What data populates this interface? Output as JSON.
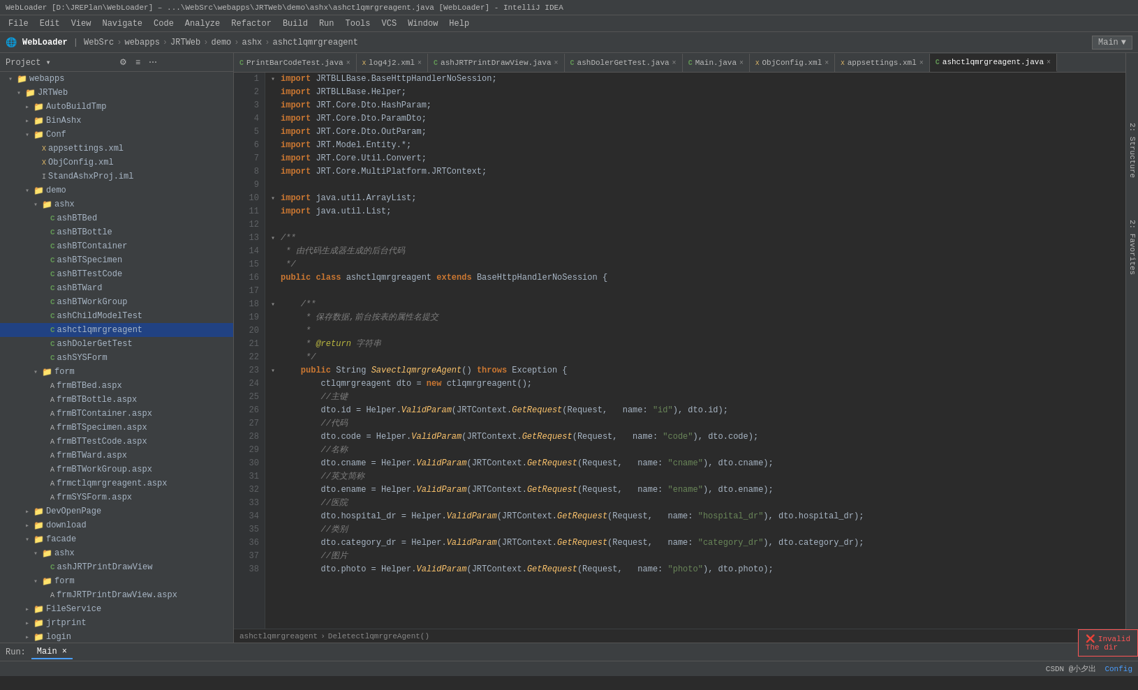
{
  "titlebar": {
    "text": "WebLoader [D:\\JREPlan\\WebLoader] – ...\\WebSrc\\webapps\\JRTWeb\\demo\\ashx\\ashctlqmrgreagent.java [WebLoader] - IntelliJ IDEA"
  },
  "menubar": {
    "items": [
      "File",
      "Edit",
      "View",
      "Navigate",
      "Code",
      "Analyze",
      "Refactor",
      "Build",
      "Run",
      "Tools",
      "VCS",
      "Window",
      "Help"
    ]
  },
  "toolbar": {
    "project_label": "WebLoader",
    "breadcrumb": [
      "WebSrc",
      "webapps",
      "JRTWeb",
      "demo",
      "ashx",
      "ashctlqmrgreagent"
    ],
    "run_config": "Main"
  },
  "project_panel": {
    "title": "Project",
    "tree": [
      {
        "id": "webapps",
        "label": "webapps",
        "type": "folder",
        "indent": 1,
        "expanded": true
      },
      {
        "id": "jrtweb",
        "label": "JRTWeb",
        "type": "folder",
        "indent": 2,
        "expanded": true
      },
      {
        "id": "autobuildtmp",
        "label": "AutoBuildTmp",
        "type": "folder",
        "indent": 3,
        "expanded": false
      },
      {
        "id": "binashx",
        "label": "BinAshx",
        "type": "folder",
        "indent": 3,
        "expanded": false
      },
      {
        "id": "conf",
        "label": "Conf",
        "type": "folder",
        "indent": 3,
        "expanded": true
      },
      {
        "id": "appsettings",
        "label": "appsettings.xml",
        "type": "xml",
        "indent": 4
      },
      {
        "id": "objconfig",
        "label": "ObjConfig.xml",
        "type": "xml",
        "indent": 4
      },
      {
        "id": "standashxproj",
        "label": "StandAshxProj.iml",
        "type": "iml",
        "indent": 4
      },
      {
        "id": "demo",
        "label": "demo",
        "type": "folder",
        "indent": 3,
        "expanded": true
      },
      {
        "id": "ashx",
        "label": "ashx",
        "type": "folder",
        "indent": 4,
        "expanded": true
      },
      {
        "id": "ashbtbed",
        "label": "ashBTBed",
        "type": "java",
        "indent": 5
      },
      {
        "id": "ashbtbottle",
        "label": "ashBTBottle",
        "type": "java",
        "indent": 5
      },
      {
        "id": "ashbtcontainer",
        "label": "ashBTContainer",
        "type": "java",
        "indent": 5
      },
      {
        "id": "ashbtspecimen",
        "label": "ashBTSpecimen",
        "type": "java",
        "indent": 5
      },
      {
        "id": "ashtbtestcode",
        "label": "ashBTTestCode",
        "type": "java",
        "indent": 5
      },
      {
        "id": "ashbtward",
        "label": "ashBTWard",
        "type": "java",
        "indent": 5
      },
      {
        "id": "ashbtworkgroup",
        "label": "ashBTWorkGroup",
        "type": "java",
        "indent": 5
      },
      {
        "id": "ashchildmodeltest",
        "label": "ashChildModelTest",
        "type": "java",
        "indent": 5
      },
      {
        "id": "ashctlqmrgreagent",
        "label": "ashctlqmrgreagent",
        "type": "java",
        "indent": 5,
        "selected": true
      },
      {
        "id": "ashdolergettest",
        "label": "ashDolerGetTest",
        "type": "java",
        "indent": 5
      },
      {
        "id": "ashsysform",
        "label": "ashSYSForm",
        "type": "java",
        "indent": 5
      },
      {
        "id": "form",
        "label": "form",
        "type": "folder",
        "indent": 4,
        "expanded": true
      },
      {
        "id": "frmbtbed",
        "label": "frmBTBed.aspx",
        "type": "aspx",
        "indent": 5
      },
      {
        "id": "frmbtbottle",
        "label": "frmBTBottle.aspx",
        "type": "aspx",
        "indent": 5
      },
      {
        "id": "frmbtcontainer",
        "label": "frmBTContainer.aspx",
        "type": "aspx",
        "indent": 5
      },
      {
        "id": "frmbtspecimen",
        "label": "frmBTSpecimen.aspx",
        "type": "aspx",
        "indent": 5
      },
      {
        "id": "frmbttestcode",
        "label": "frmBTTestCode.aspx",
        "type": "aspx",
        "indent": 5
      },
      {
        "id": "frmbtward",
        "label": "frmBTWard.aspx",
        "type": "aspx",
        "indent": 5
      },
      {
        "id": "frmbtworkgroup",
        "label": "frmBTWorkGroup.aspx",
        "type": "aspx",
        "indent": 5
      },
      {
        "id": "frmctlqmrgreagent",
        "label": "frmctlqmrgreagent.aspx",
        "type": "aspx",
        "indent": 5
      },
      {
        "id": "frmsysform",
        "label": "frmSYSForm.aspx",
        "type": "aspx",
        "indent": 5
      },
      {
        "id": "devopenpage",
        "label": "DevOpenPage",
        "type": "folder",
        "indent": 3,
        "expanded": false
      },
      {
        "id": "download",
        "label": "download",
        "type": "folder",
        "indent": 3,
        "expanded": false
      },
      {
        "id": "facade",
        "label": "facade",
        "type": "folder",
        "indent": 3,
        "expanded": true
      },
      {
        "id": "facade-ashx",
        "label": "ashx",
        "type": "folder",
        "indent": 4,
        "expanded": true
      },
      {
        "id": "ashJRTPrintDrawView",
        "label": "ashJRTPrintDrawView",
        "type": "java",
        "indent": 5
      },
      {
        "id": "facade-form",
        "label": "form",
        "type": "folder",
        "indent": 4,
        "expanded": true
      },
      {
        "id": "frmJRTPrintDrawView",
        "label": "frmJRTPrintDrawView.aspx",
        "type": "aspx",
        "indent": 5
      },
      {
        "id": "fileservice",
        "label": "FileService",
        "type": "folder",
        "indent": 3,
        "expanded": false
      },
      {
        "id": "jrtprint",
        "label": "jrtprint",
        "type": "folder",
        "indent": 3,
        "expanded": false
      },
      {
        "id": "login",
        "label": "login",
        "type": "folder",
        "indent": 3,
        "expanded": false
      }
    ]
  },
  "editor": {
    "tabs": [
      {
        "id": "printbarcodetest",
        "label": "PrintBarCodeTest.java",
        "type": "java",
        "active": false
      },
      {
        "id": "log4j2",
        "label": "log4j2.xml",
        "type": "xml",
        "active": false
      },
      {
        "id": "ashJRTPrintDrawView",
        "label": "ashJRTPrintDrawView.java",
        "type": "java",
        "active": false
      },
      {
        "id": "ashDolerGetTest",
        "label": "ashDolerGetTest.java",
        "type": "java",
        "active": false
      },
      {
        "id": "main",
        "label": "Main.java",
        "type": "java",
        "active": false
      },
      {
        "id": "objconfig",
        "label": "ObjConfig.xml",
        "type": "xml",
        "active": false
      },
      {
        "id": "appsettings",
        "label": "appsettings.xml",
        "type": "xml",
        "active": false
      },
      {
        "id": "ashctlqmrgreagent",
        "label": "ashctlqmrgreagent.java",
        "type": "java",
        "active": true
      }
    ],
    "breadcrumb": "ashctlqmrgreagent > DeletectlqmrgreAgent()",
    "lines": [
      {
        "n": 1,
        "fold": true,
        "code": "<kw>import</kw> JRTBLLBase.BaseHttpHandlerNoSession;"
      },
      {
        "n": 2,
        "fold": false,
        "code": "<kw>import</kw> JRTBLLBase.Helper;"
      },
      {
        "n": 3,
        "fold": false,
        "code": "<kw>import</kw> JRT.Core.Dto.HashParam;"
      },
      {
        "n": 4,
        "fold": false,
        "code": "<kw>import</kw> JRT.Core.Dto.ParamDto;"
      },
      {
        "n": 5,
        "fold": false,
        "code": "<kw>import</kw> JRT.Core.Dto.OutParam;"
      },
      {
        "n": 6,
        "fold": false,
        "code": "<kw>import</kw> JRT.Model.Entity.*;"
      },
      {
        "n": 7,
        "fold": false,
        "code": "<kw>import</kw> JRT.Core.Util.Convert;"
      },
      {
        "n": 8,
        "fold": false,
        "code": "<kw>import</kw> JRT.Core.MultiPlatform.JRTContext;"
      },
      {
        "n": 9,
        "fold": false,
        "code": ""
      },
      {
        "n": 10,
        "fold": true,
        "code": "<kw>import</kw> java.util.ArrayList;"
      },
      {
        "n": 11,
        "fold": false,
        "code": "<kw>import</kw> java.util.List;"
      },
      {
        "n": 12,
        "fold": false,
        "code": ""
      },
      {
        "n": 13,
        "fold": true,
        "code": "<comment>/**</comment>"
      },
      {
        "n": 14,
        "fold": false,
        "code": "<comment> * 由代码生成器生成的后台代码</comment>"
      },
      {
        "n": 15,
        "fold": false,
        "code": "<comment> */</comment>"
      },
      {
        "n": 16,
        "fold": false,
        "code": "<kw>public</kw> <kw>class</kw> <class>ashctlqmrgreagent</class> <kw>extends</kw> BaseHttpHandlerNoSession {"
      },
      {
        "n": 17,
        "fold": false,
        "code": ""
      },
      {
        "n": 18,
        "fold": true,
        "code": "    <comment>/**</comment>"
      },
      {
        "n": 19,
        "fold": false,
        "code": "     <comment>* 保存数据,前台按表的属性名提交</comment>"
      },
      {
        "n": 20,
        "fold": false,
        "code": "     <comment>*</comment>"
      },
      {
        "n": 21,
        "fold": false,
        "code": "     <comment>* <annotation>@return</annotation> 字符串</comment>"
      },
      {
        "n": 22,
        "fold": false,
        "code": "     <comment>*/</comment>"
      },
      {
        "n": 23,
        "fold": true,
        "code": "    <kw>public</kw> String <method>SavectlqmrgreAgent</method>() <kw>throws</kw> Exception {"
      },
      {
        "n": 24,
        "fold": false,
        "code": "        ctlqmrgreagent dto = <kw>new</kw> ctlqmrgreagent();"
      },
      {
        "n": 25,
        "fold": false,
        "code": "        <comment>//主键</comment>"
      },
      {
        "n": 26,
        "fold": false,
        "code": "        dto.id = Helper.<method>ValidParam</method>(JRTContext.<method>GetRequest</method>(Request,   name: <string>\"id\"</string>), dto.id);"
      },
      {
        "n": 27,
        "fold": false,
        "code": "        <comment>//代码</comment>"
      },
      {
        "n": 28,
        "fold": false,
        "code": "        dto.code = Helper.<method>ValidParam</method>(JRTContext.<method>GetRequest</method>(Request,   name: <string>\"code\"</string>), dto.code);"
      },
      {
        "n": 29,
        "fold": false,
        "code": "        <comment>//名称</comment>"
      },
      {
        "n": 30,
        "fold": false,
        "code": "        dto.cname = Helper.<method>ValidParam</method>(JRTContext.<method>GetRequest</method>(Request,   name: <string>\"cname\"</string>), dto.cname);"
      },
      {
        "n": 31,
        "fold": false,
        "code": "        <comment>//英文简称</comment>"
      },
      {
        "n": 32,
        "fold": false,
        "code": "        dto.ename = Helper.<method>ValidParam</method>(JRTContext.<method>GetRequest</method>(Request,   name: <string>\"ename\"</string>), dto.ename);"
      },
      {
        "n": 33,
        "fold": false,
        "code": "        <comment>//医院</comment>"
      },
      {
        "n": 34,
        "fold": false,
        "code": "        dto.hospital_dr = Helper.<method>ValidParam</method>(JRTContext.<method>GetRequest</method>(Request,   name: <string>\"hospital_dr\"</string>), dto.hospital_dr);"
      },
      {
        "n": 35,
        "fold": false,
        "code": "        <comment>//类别</comment>"
      },
      {
        "n": 36,
        "fold": false,
        "code": "        dto.category_dr = Helper.<method>ValidParam</method>(JRTContext.<method>GetRequest</method>(Request,   name: <string>\"category_dr\"</string>), dto.category_dr);"
      },
      {
        "n": 37,
        "fold": false,
        "code": "        <comment>//图片</comment>"
      },
      {
        "n": 38,
        "fold": false,
        "code": "        dto.photo = Helper.<method>ValidParam</method>(JRTContext.<method>GetRequest</method>(Request,   name: <string>\"photo\"</string>), dto.photo);"
      }
    ]
  },
  "run_bar": {
    "tabs": [
      "Run:",
      "Main"
    ]
  },
  "statusbar": {
    "left": "",
    "right_items": [
      "CSDN @小夕出",
      "Config"
    ]
  },
  "error_tooltip": {
    "icon": "❌",
    "line1": "Invalid",
    "line2": "The dir"
  },
  "right_vtabs": [
    "2: Structure",
    "2: Favorites"
  ]
}
